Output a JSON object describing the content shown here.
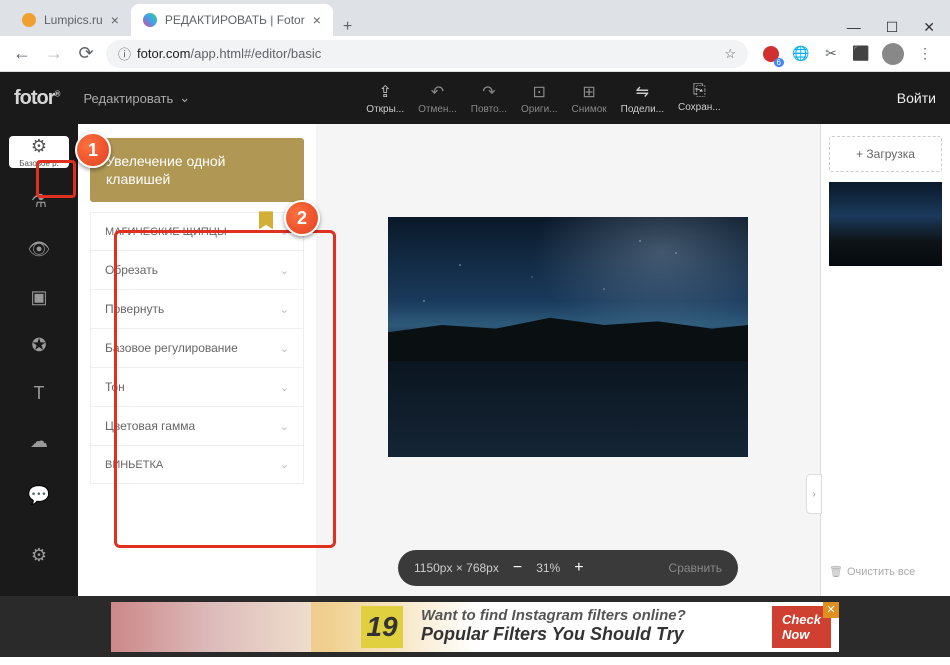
{
  "window": {
    "min": "—",
    "max": "☐",
    "close": "✕"
  },
  "tabs": {
    "items": [
      {
        "title": "Lumpics.ru",
        "favicon": "#f0a030",
        "active": false
      },
      {
        "title": "РЕДАКТИРОВАТЬ | Fotor",
        "favicon": "#4080f0",
        "active": true
      }
    ],
    "new": "+"
  },
  "addr": {
    "back": "←",
    "fwd": "→",
    "reload": "⟳",
    "lock": "ⓘ",
    "host": "fotor.com",
    "path": "/app.html#/editor/basic",
    "star": "☆",
    "menu": "⋮"
  },
  "ext_badge": "6",
  "toolbar": {
    "logo": "fotor",
    "reg": "®",
    "mode": "Редактировать",
    "chev": "⌄",
    "items": [
      {
        "icon": "⇪",
        "label": "Откры..."
      },
      {
        "icon": "↶",
        "label": "Отмен..."
      },
      {
        "icon": "↷",
        "label": "Повто..."
      },
      {
        "icon": "⊡",
        "label": "Ориги..."
      },
      {
        "icon": "⊞",
        "label": "Снимок"
      },
      {
        "icon": "⇋",
        "label": "Подели..."
      },
      {
        "icon": "⎘",
        "label": "Сохран..."
      }
    ],
    "login": "Войти"
  },
  "rail": {
    "items": [
      {
        "icon": "⚙",
        "label": "Базовое р."
      },
      {
        "icon": "⚗",
        "label": ""
      },
      {
        "icon": "👁",
        "label": ""
      },
      {
        "icon": "▣",
        "label": ""
      },
      {
        "icon": "✪",
        "label": ""
      },
      {
        "icon": "T",
        "label": ""
      },
      {
        "icon": "☁",
        "label": ""
      }
    ],
    "bottom": [
      {
        "icon": "💬"
      },
      {
        "icon": "⚙"
      }
    ]
  },
  "panel": {
    "oneTap": "Увелечение одной клавишей",
    "items": [
      {
        "label": "МАГИЧЕСКИЕ ЩИПЦЫ",
        "upper": true,
        "bookmark": true
      },
      {
        "label": "Обрезать"
      },
      {
        "label": "Повернуть"
      },
      {
        "label": "Базовое регулирование"
      },
      {
        "label": "Тон"
      },
      {
        "label": "Цветовая гамма"
      },
      {
        "label": "ВИНЬЕТКА",
        "upper": true
      }
    ],
    "chev": "⌄"
  },
  "zoom": {
    "dims": "1150px × 768px",
    "minus": "−",
    "pct": "31%",
    "plus": "+",
    "compare": "Сравнить"
  },
  "right": {
    "upload": "+  Загрузка",
    "expand": "›",
    "clear": "Очистить все",
    "trash": "🗑"
  },
  "ad": {
    "num": "19",
    "line1": "Want to find Instagram filters online?",
    "line2": "Popular Filters You Should Try",
    "btn1": "Check",
    "btn2": "Now",
    "close": "✕"
  },
  "callouts": {
    "c1": "1",
    "c2": "2"
  }
}
